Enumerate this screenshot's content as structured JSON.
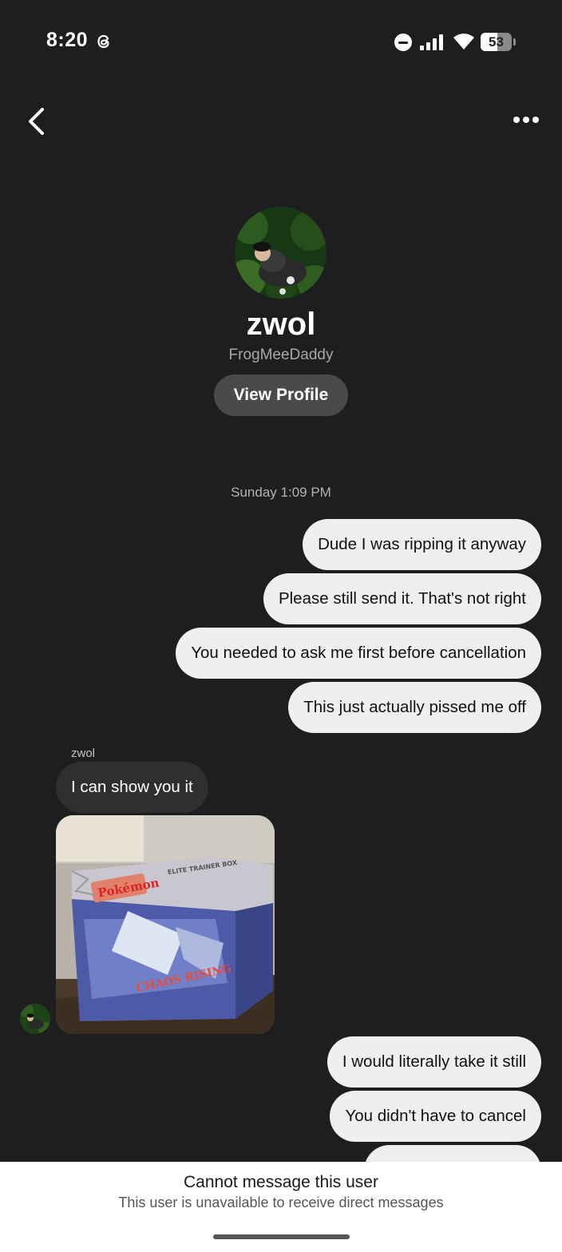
{
  "status_bar": {
    "time": "8:20",
    "battery_level": "53",
    "icons": [
      "threads-icon",
      "do-not-disturb-icon",
      "signal-icon",
      "wifi-icon",
      "battery-icon"
    ]
  },
  "header": {
    "back_icon": "chevron-left-icon",
    "more_icon": "more-horizontal-icon"
  },
  "profile": {
    "name": "zwol",
    "handle": "FrogMeeDaddy",
    "view_profile_label": "View Profile"
  },
  "conversation": {
    "timestamp": "Sunday 1:09 PM",
    "sender_label": "zwol",
    "messages_out_1": [
      "Dude I was ripping it anyway",
      "Please still send it. That's not right",
      "You needed to ask me first before cancellation",
      "This just actually pissed me off"
    ],
    "message_in": "I can show you it",
    "photo_text": {
      "brand": "Pokémon",
      "product_line": "ELITE TRAINER BOX",
      "set_name": "CHAOS RISING"
    },
    "messages_out_2": [
      "I would literally take it still",
      "You didn't have to cancel"
    ]
  },
  "footer": {
    "title": "Cannot message this user",
    "subtitle": "This user is unavailable to receive direct messages"
  },
  "colors": {
    "background": "#1e1e20",
    "outgoing_bubble": "#efefef",
    "incoming_bubble": "#2f2f31",
    "button": "#4a4a4c",
    "footer": "#ffffff"
  }
}
